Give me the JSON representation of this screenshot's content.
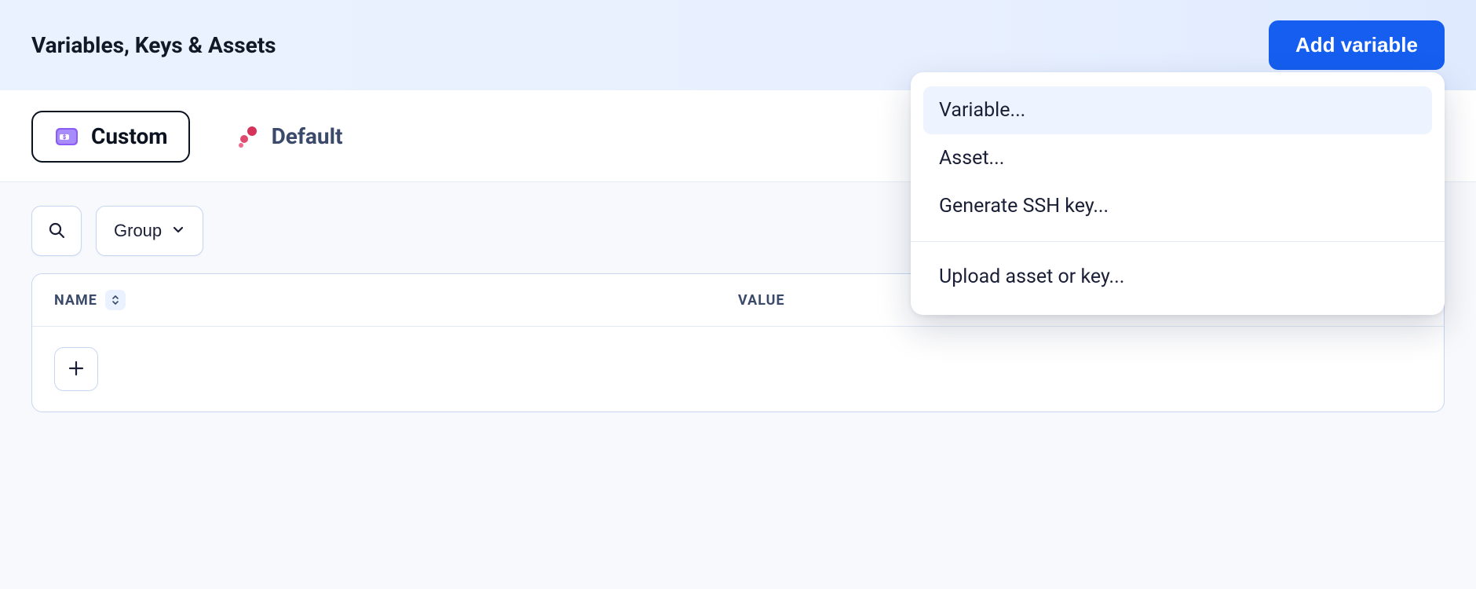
{
  "header": {
    "title": "Variables, Keys & Assets",
    "add_button": "Add variable"
  },
  "tabs": {
    "custom": {
      "label": "Custom"
    },
    "default": {
      "label": "Default"
    }
  },
  "toolbar": {
    "group_label": "Group"
  },
  "table": {
    "columns": {
      "name": "NAME",
      "value": "VALUE"
    }
  },
  "dropdown": {
    "items": [
      {
        "label": "Variable...",
        "selected": true
      },
      {
        "label": "Asset...",
        "selected": false
      },
      {
        "label": "Generate SSH key...",
        "selected": false
      }
    ],
    "secondary": [
      {
        "label": "Upload asset or key..."
      }
    ]
  }
}
